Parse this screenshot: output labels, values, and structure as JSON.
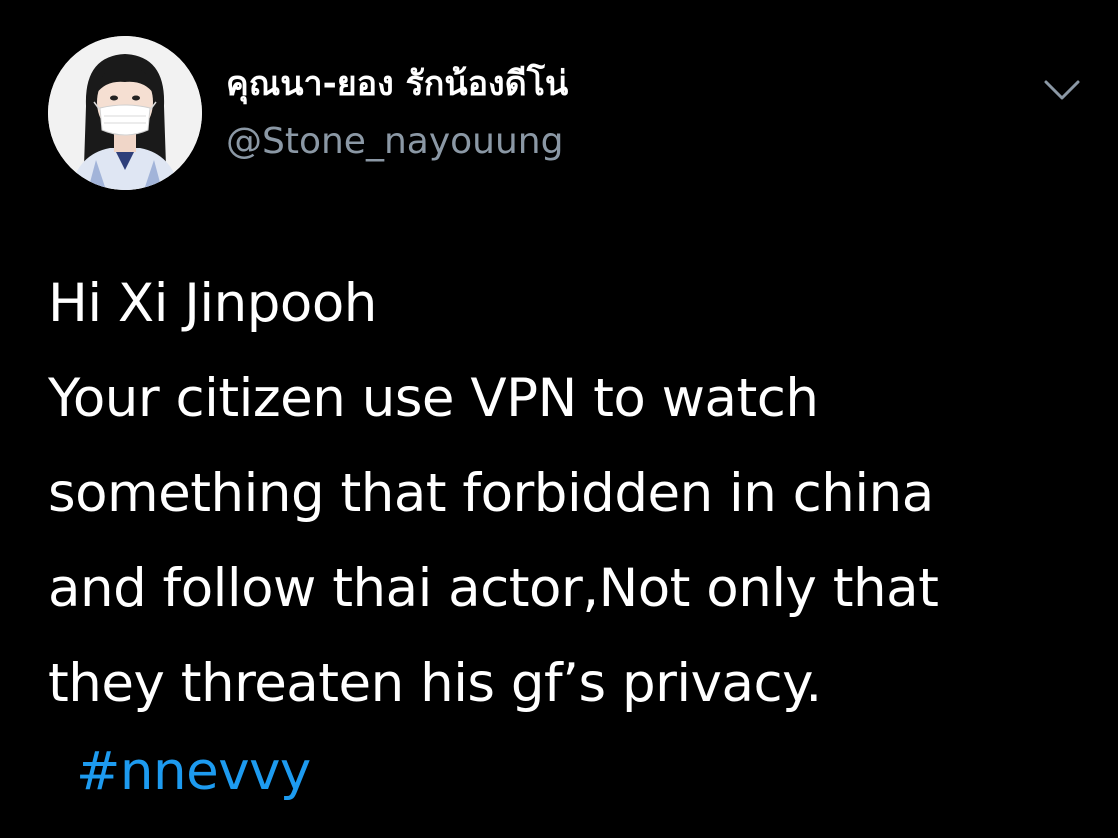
{
  "tweet": {
    "author": {
      "display_name": "คุณนา-ยอง รักน้องดีโน่",
      "handle": "@Stone_nayouung",
      "avatar": "profile-photo"
    },
    "menu_icon": "chevron-down-icon",
    "text_lines": [
      "Hi Xi Jinpooh",
      "Your citizen use VPN to watch",
      "something that forbidden in china",
      "and follow thai actor,Not only that",
      "they threaten his gf’s privacy."
    ],
    "hashtag": "#nnevvy"
  },
  "colors": {
    "background": "#000000",
    "text": "#ffffff",
    "secondary_text": "#8b98a5",
    "link": "#1d9bf0",
    "icon": "#8b98a5"
  }
}
